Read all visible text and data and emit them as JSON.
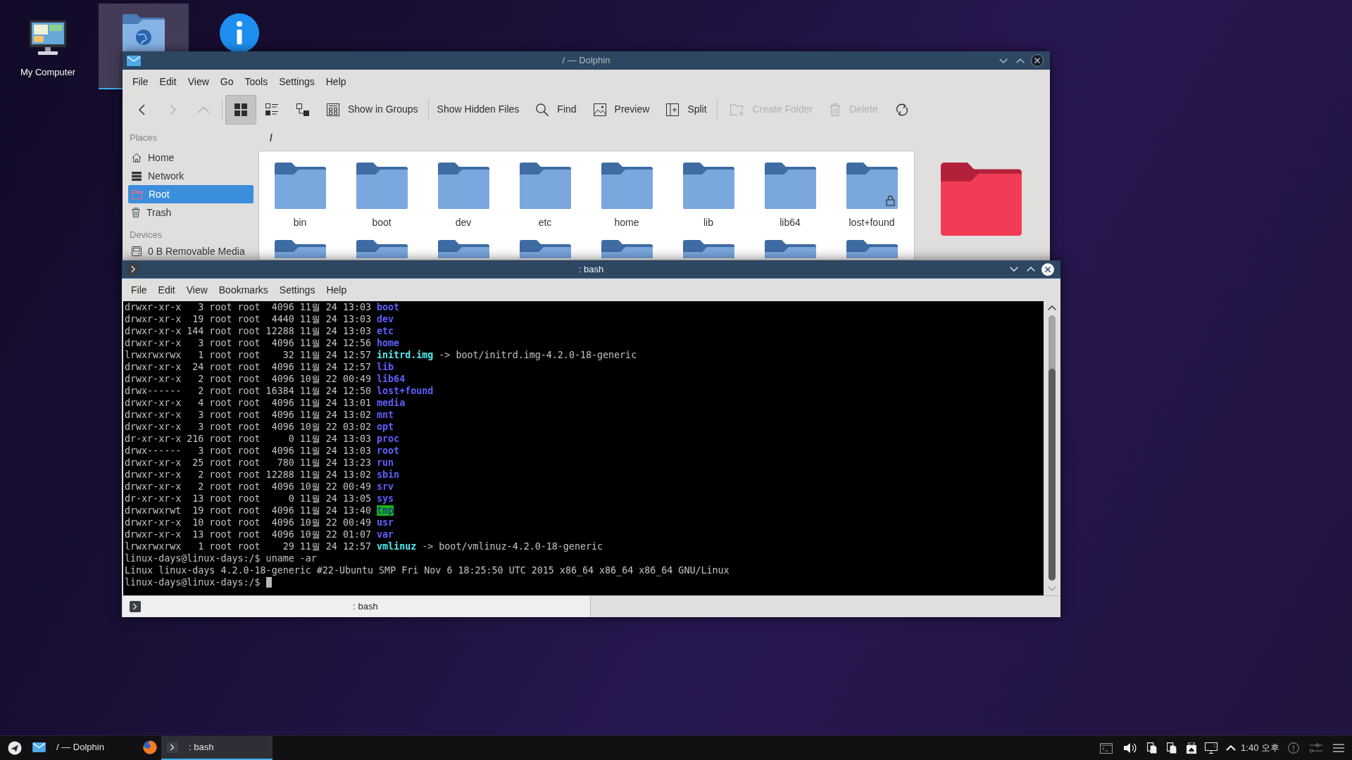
{
  "desktop": {
    "icons": [
      {
        "kind": "computer",
        "label": "My Computer",
        "selected": false
      },
      {
        "kind": "globe-folder",
        "selected": true
      },
      {
        "kind": "info",
        "selected": false
      }
    ]
  },
  "file_manager": {
    "title": "/ — Dolphin",
    "menu": [
      "File",
      "Edit",
      "View",
      "Go",
      "Tools",
      "Settings",
      "Help"
    ],
    "toolbar": [
      {
        "items": [
          {
            "kind": "back",
            "disabled": false
          },
          {
            "kind": "forward",
            "disabled": true
          },
          {
            "kind": "up",
            "disabled": true
          }
        ]
      },
      {
        "items": [
          {
            "kind": "icons-view",
            "selected": true
          },
          {
            "kind": "details-view",
            "selected": false
          },
          {
            "kind": "compact-view",
            "selected": false
          },
          {
            "kind": "groups",
            "label": "Show in Groups",
            "disabled": false
          }
        ]
      },
      {
        "items": [
          {
            "kind": "hidden-files",
            "label": "Show Hidden Files",
            "disabled": false
          },
          {
            "kind": "find",
            "label": "Find",
            "disabled": false
          },
          {
            "kind": "preview",
            "label": "Preview",
            "disabled": false
          },
          {
            "kind": "split",
            "label": "Split",
            "disabled": false
          }
        ]
      },
      {
        "items": [
          {
            "kind": "create-folder",
            "label": "Create Folder",
            "disabled": true
          },
          {
            "kind": "delete",
            "label": "Delete",
            "disabled": true
          },
          {
            "kind": "reload",
            "disabled": false
          }
        ]
      }
    ],
    "places": [
      {
        "heading": "Places",
        "items": [
          {
            "kind": "home",
            "label": "Home",
            "selected": false
          },
          {
            "kind": "network",
            "label": "Network",
            "selected": false
          },
          {
            "kind": "root",
            "label": "Root",
            "selected": true
          },
          {
            "kind": "trash",
            "label": "Trash",
            "selected": false
          }
        ]
      },
      {
        "heading": "Devices",
        "items": [
          {
            "kind": "drive",
            "label": "0 B Removable Media",
            "selected": false
          }
        ]
      }
    ],
    "location": "/",
    "folders": [
      {
        "kind": "folder",
        "name": "bin",
        "locked": false
      },
      {
        "kind": "folder",
        "name": "boot",
        "locked": false
      },
      {
        "kind": "folder",
        "name": "dev",
        "locked": false
      },
      {
        "kind": "folder",
        "name": "etc",
        "locked": false
      },
      {
        "kind": "folder",
        "name": "home",
        "locked": false
      },
      {
        "kind": "folder",
        "name": "lib",
        "locked": false
      },
      {
        "kind": "folder",
        "name": "lib64",
        "locked": false
      },
      {
        "kind": "folder",
        "name": "lost+found",
        "locked": true
      },
      {
        "kind": "folder"
      },
      {
        "kind": "folder"
      },
      {
        "kind": "folder"
      },
      {
        "kind": "folder"
      },
      {
        "kind": "folder"
      },
      {
        "kind": "folder"
      },
      {
        "kind": "folder"
      },
      {
        "kind": "folder"
      }
    ]
  },
  "terminal": {
    "title": ": bash",
    "menu": [
      "File",
      "Edit",
      "View",
      "Bookmarks",
      "Settings",
      "Help"
    ],
    "lines": [
      {
        "kind": "directory",
        "text": "drwxr-xr-x   3 root root  4096 11월 24 13:03",
        "name": "boot"
      },
      {
        "kind": "directory",
        "text": "drwxr-xr-x  19 root root  4440 11월 24 13:03",
        "name": "dev"
      },
      {
        "kind": "directory",
        "text": "drwxr-xr-x 144 root root 12288 11월 24 13:03",
        "name": "etc"
      },
      {
        "kind": "directory",
        "text": "drwxr-xr-x   3 root root  4096 11월 24 12:56",
        "name": "home"
      },
      {
        "kind": "symlink",
        "text": "lrwxrwxrwx   1 root root    32 11월 24 12:57",
        "name": "initrd.img",
        "target": "-> boot/initrd.img-4.2.0-18-generic"
      },
      {
        "kind": "directory",
        "text": "drwxr-xr-x  24 root root  4096 11월 24 12:57",
        "name": "lib"
      },
      {
        "kind": "directory",
        "text": "drwxr-xr-x   2 root root  4096 10월 22 00:49",
        "name": "lib64"
      },
      {
        "kind": "directory",
        "text": "drwx------   2 root root 16384 11월 24 12:50",
        "name": "lost+found"
      },
      {
        "kind": "directory",
        "text": "drwxr-xr-x   4 root root  4096 11월 24 13:01",
        "name": "media"
      },
      {
        "kind": "directory",
        "text": "drwxr-xr-x   3 root root  4096 11월 24 13:02",
        "name": "mnt"
      },
      {
        "kind": "directory",
        "text": "drwxr-xr-x   3 root root  4096 10월 22 03:02",
        "name": "opt"
      },
      {
        "kind": "directory",
        "text": "dr-xr-xr-x 216 root root     0 11월 24 13:03",
        "name": "proc"
      },
      {
        "kind": "directory",
        "text": "drwx------   3 root root  4096 11월 24 13:03",
        "name": "root"
      },
      {
        "kind": "directory",
        "text": "drwxr-xr-x  25 root root   780 11월 24 13:23",
        "name": "run"
      },
      {
        "kind": "directory",
        "text": "drwxr-xr-x   2 root root 12288 11월 24 13:02",
        "name": "sbin"
      },
      {
        "kind": "directory",
        "text": "drwxr-xr-x   2 root root  4096 10월 22 00:49",
        "name": "srv"
      },
      {
        "kind": "directory",
        "text": "dr-xr-xr-x  13 root root     0 11월 24 13:05",
        "name": "sys"
      },
      {
        "kind": "sticky-directory",
        "text": "drwxrwxrwt  19 root root  4096 11월 24 13:40",
        "name": "tmp"
      },
      {
        "kind": "directory",
        "text": "drwxr-xr-x  10 root root  4096 10월 22 00:49",
        "name": "usr"
      },
      {
        "kind": "directory",
        "text": "drwxr-xr-x  13 root root  4096 10월 22 01:07",
        "name": "var"
      },
      {
        "kind": "symlink",
        "text": "lrwxrwxrwx   1 root root    29 11월 24 12:57",
        "name": "vmlinuz",
        "target": "-> boot/vmlinuz-4.2.0-18-generic"
      },
      {
        "kind": "prompt",
        "text": "linux-days@linux-days:/$ uname -ar",
        "cursor": false
      },
      {
        "kind": "output",
        "text": "Linux linux-days 4.2.0-18-generic #22-Ubuntu SMP Fri Nov 6 18:25:50 UTC 2015 x86_64 x86_64 x86_64 GNU/Linux"
      },
      {
        "kind": "prompt",
        "text": "linux-days@linux-days:/$",
        "cursor": true
      }
    ],
    "tabs": [
      {
        "label": ": bash",
        "selected": true
      }
    ]
  },
  "taskbar": {
    "tasks": [
      {
        "kind": "file-manager",
        "label": "/ — Dolphin",
        "selected": false
      },
      {
        "kind": "browser",
        "selected": false
      },
      {
        "kind": "terminal",
        "label": ": bash",
        "selected": true
      }
    ],
    "clock": "1:40 오후"
  }
}
